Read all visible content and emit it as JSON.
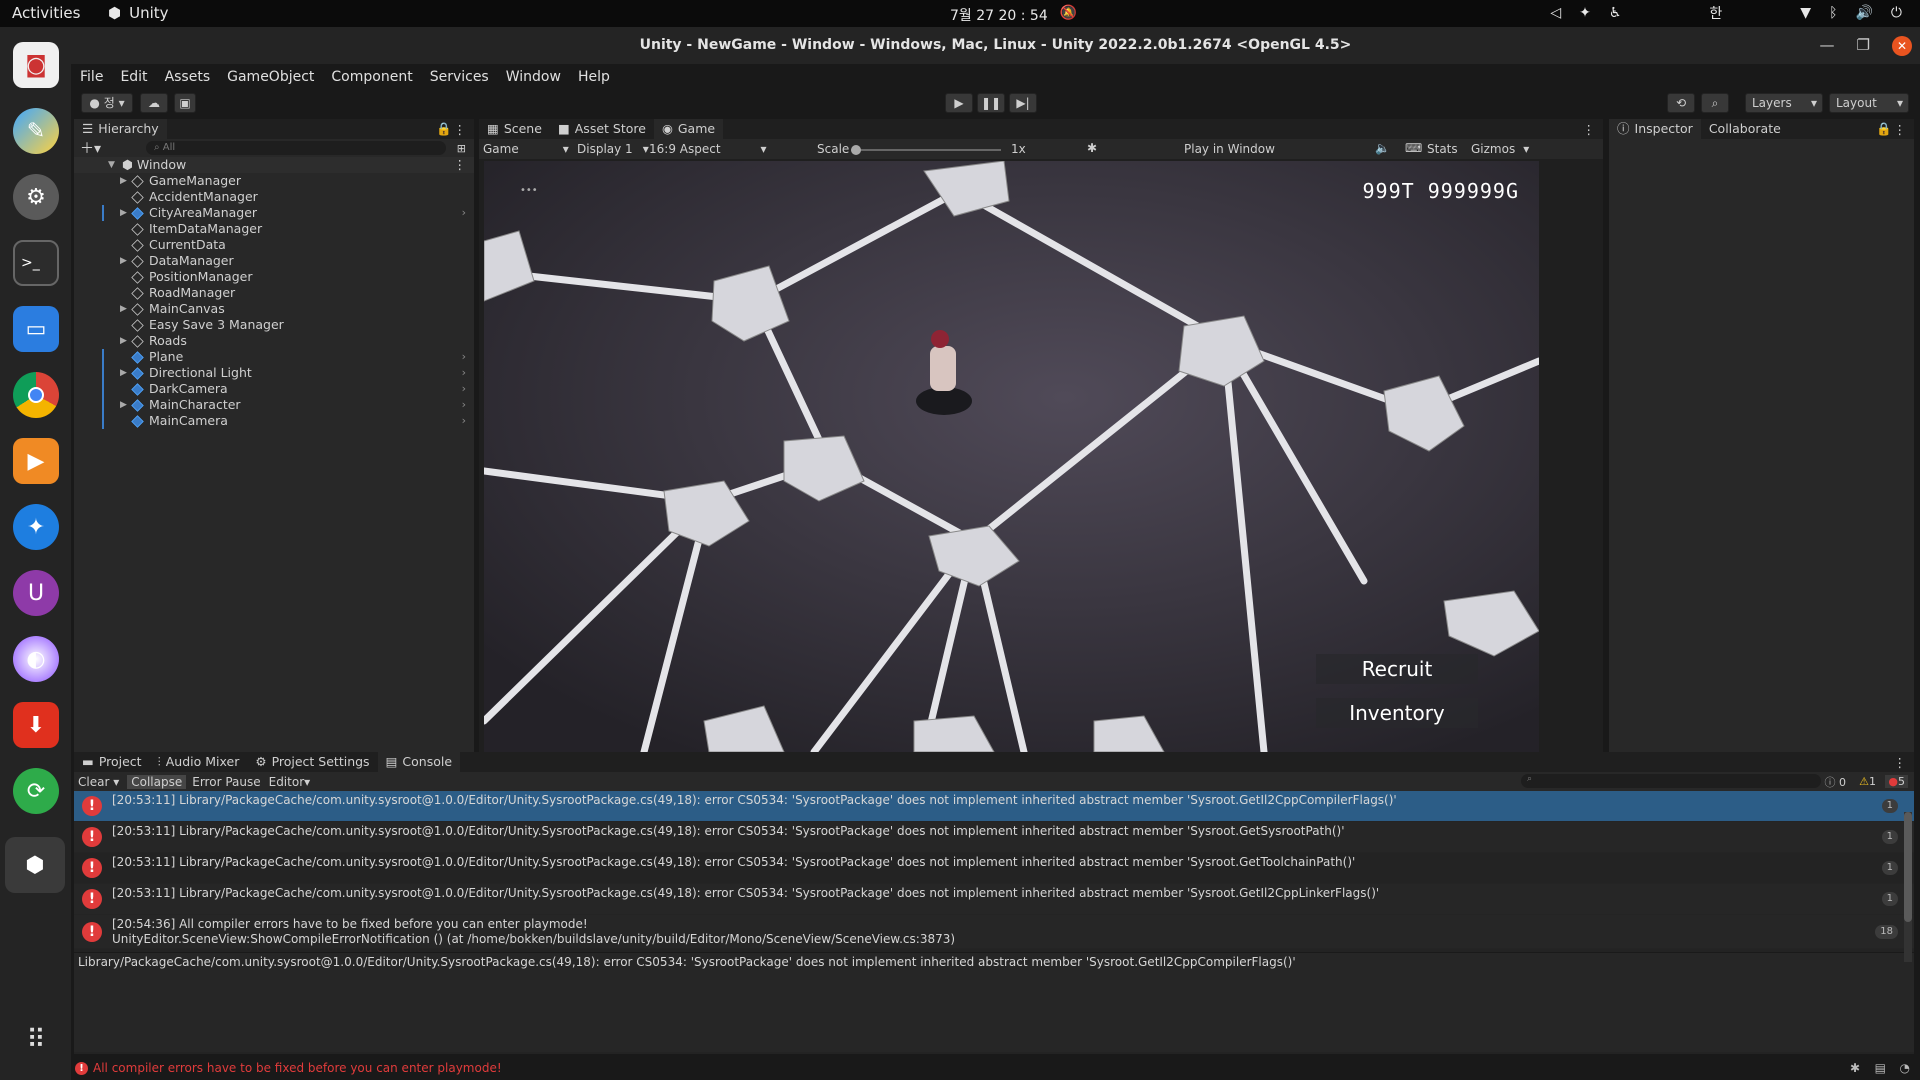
{
  "topbar": {
    "activities": "Activities",
    "app": "Unity",
    "clock": "7월 27  20 : 54",
    "ime": "한"
  },
  "window": {
    "title": "Unity - NewGame - Window - Windows, Mac, Linux - Unity 2022.2.0b1.2674 <OpenGL 4.5>"
  },
  "menu": [
    "File",
    "Edit",
    "Assets",
    "GameObject",
    "Component",
    "Services",
    "Window",
    "Help"
  ],
  "toolbar": {
    "account_label": "정",
    "layers": "Layers",
    "layout": "Layout"
  },
  "hierarchy": {
    "tab": "Hierarchy",
    "search_placeholder": "All",
    "root": "Window",
    "items": [
      {
        "name": "GameManager",
        "arrow": true,
        "style": "normal"
      },
      {
        "name": "AccidentManager",
        "arrow": false,
        "style": "normal"
      },
      {
        "name": "CityAreaManager",
        "arrow": true,
        "style": "blue"
      },
      {
        "name": "ItemDataManager",
        "arrow": false,
        "style": "normal"
      },
      {
        "name": "CurrentData",
        "arrow": false,
        "style": "normal"
      },
      {
        "name": "DataManager",
        "arrow": true,
        "style": "normal"
      },
      {
        "name": "PositionManager",
        "arrow": false,
        "style": "normal"
      },
      {
        "name": "RoadManager",
        "arrow": false,
        "style": "normal"
      },
      {
        "name": "MainCanvas",
        "arrow": true,
        "style": "normal"
      },
      {
        "name": "Easy Save 3 Manager",
        "arrow": false,
        "style": "normal"
      },
      {
        "name": "Roads",
        "arrow": true,
        "style": "normal"
      },
      {
        "name": "Plane",
        "arrow": false,
        "style": "blue"
      },
      {
        "name": "Directional Light",
        "arrow": true,
        "style": "blue"
      },
      {
        "name": "DarkCamera",
        "arrow": false,
        "style": "dim"
      },
      {
        "name": "MainCharacter",
        "arrow": true,
        "style": "blue"
      },
      {
        "name": "MainCamera",
        "arrow": false,
        "style": "blue"
      }
    ]
  },
  "center_tabs": {
    "scene": "Scene",
    "asset_store": "Asset Store",
    "game": "Game"
  },
  "game_toolbar": {
    "game": "Game",
    "display": "Display 1",
    "aspect": "16:9 Aspect",
    "scale_label": "Scale",
    "scale_value": "1x",
    "play_mode": "Play in Window",
    "stats": "Stats",
    "gizmos": "Gizmos"
  },
  "game_ui": {
    "money": "999T  999999G",
    "recruit": "Recruit",
    "inventory": "Inventory",
    "dots": "•••"
  },
  "right_tabs": {
    "inspector": "Inspector",
    "collaborate": "Collaborate"
  },
  "bottom_tabs": {
    "project": "Project",
    "audio_mixer": "Audio Mixer",
    "project_settings": "Project Settings",
    "console": "Console"
  },
  "console_toolbar": {
    "clear": "Clear",
    "collapse": "Collapse",
    "error_pause": "Error Pause",
    "editor": "Editor",
    "info_count": "0",
    "warn_count": "1",
    "error_count": "5"
  },
  "console": {
    "rows": [
      {
        "text": "[20:53:11] Library/PackageCache/com.unity.sysroot@1.0.0/Editor/Unity.SysrootPackage.cs(49,18): error CS0534: 'SysrootPackage' does not implement inherited abstract member 'Sysroot.GetIl2CppCompilerFlags()'",
        "count": "1",
        "selected": true
      },
      {
        "text": "[20:53:11] Library/PackageCache/com.unity.sysroot@1.0.0/Editor/Unity.SysrootPackage.cs(49,18): error CS0534: 'SysrootPackage' does not implement inherited abstract member 'Sysroot.GetSysrootPath()'",
        "count": "1",
        "selected": false
      },
      {
        "text": "[20:53:11] Library/PackageCache/com.unity.sysroot@1.0.0/Editor/Unity.SysrootPackage.cs(49,18): error CS0534: 'SysrootPackage' does not implement inherited abstract member 'Sysroot.GetToolchainPath()'",
        "count": "1",
        "selected": false
      },
      {
        "text": "[20:53:11] Library/PackageCache/com.unity.sysroot@1.0.0/Editor/Unity.SysrootPackage.cs(49,18): error CS0534: 'SysrootPackage' does not implement inherited abstract member 'Sysroot.GetIl2CppLinkerFlags()'",
        "count": "1",
        "selected": false
      }
    ],
    "last_row": {
      "line1": "[20:54:36] All compiler errors have to be fixed before you can enter playmode!",
      "line2": "UnityEditor.SceneView:ShowCompileErrorNotification () (at /home/bokken/buildslave/unity/build/Editor/Mono/SceneView/SceneView.cs:3873)",
      "count": "18"
    },
    "detail": "Library/PackageCache/com.unity.sysroot@1.0.0/Editor/Unity.SysrootPackage.cs(49,18): error CS0534: 'SysrootPackage' does not implement inherited abstract member 'Sysroot.GetIl2CppCompilerFlags()'"
  },
  "statusbar": {
    "message": "All compiler errors have to be fixed before you can enter playmode!"
  },
  "colors": {
    "accent": "#2c5d87",
    "error": "#e03b3b",
    "ubuntu_orange": "#e95420",
    "link_blue": "#5fa9ff"
  }
}
